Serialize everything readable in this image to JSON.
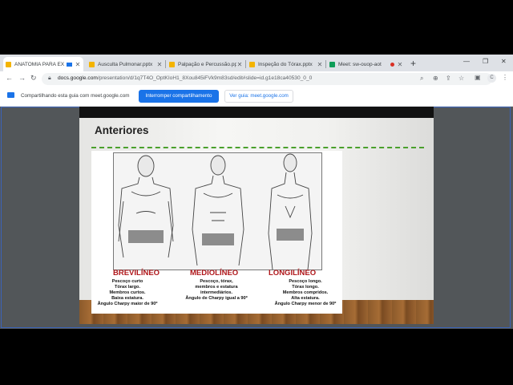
{
  "browser": {
    "tabs": [
      {
        "title": "ANATOMIA PARA EX",
        "active": true,
        "color": "#f4b400"
      },
      {
        "title": "Ausculta Pulmonar.pptx",
        "active": false,
        "color": "#f4b400"
      },
      {
        "title": "Palpação e Percussão.pptx",
        "active": false,
        "color": "#f4b400"
      },
      {
        "title": "Inspeção do Tórax.pptx",
        "active": false,
        "color": "#f4b400"
      },
      {
        "title": "Meet: sw-ouop-aot",
        "active": false,
        "color": "#0f9d58"
      }
    ],
    "new_tab": "+",
    "url_host": "docs.google.com",
    "url_path": "/presentation/d/1q7T4O_OptKIoH1_8Xou845iFVk9m83sd/edit#slide=id.g1e18ca40530_0_0",
    "profile_initial": "C"
  },
  "sharebar": {
    "message": "Compartilhando esta guia com meet.google.com",
    "stop_label": "Interromper compartilhamento",
    "view_label": "Ver guia: meet.google.com"
  },
  "slide": {
    "title": "Anteriores",
    "types": [
      {
        "name": "BREVILÍNEO",
        "desc": "Pescoço curto\nTórax largo.\nMembros curtos.\nBaixa estatura.\nÂngulo Charpy maior de 90º"
      },
      {
        "name": "MEDIOLÍNEO",
        "desc": "Pescoço, tórax,\nmembros e estatura\nintermediários.\nÂngulo de Charpy igual a 90º"
      },
      {
        "name": "LONGILÍNEO",
        "desc": "Pescoço longo.\nTórax longo.\nMembros compridos.\nAlta estatura.\nÂngulo Charpy menor de 90º"
      }
    ]
  },
  "colors": {
    "accent": "#1a73e8",
    "type_label": "#b0171b",
    "dashed_line": "#4aa02c"
  }
}
